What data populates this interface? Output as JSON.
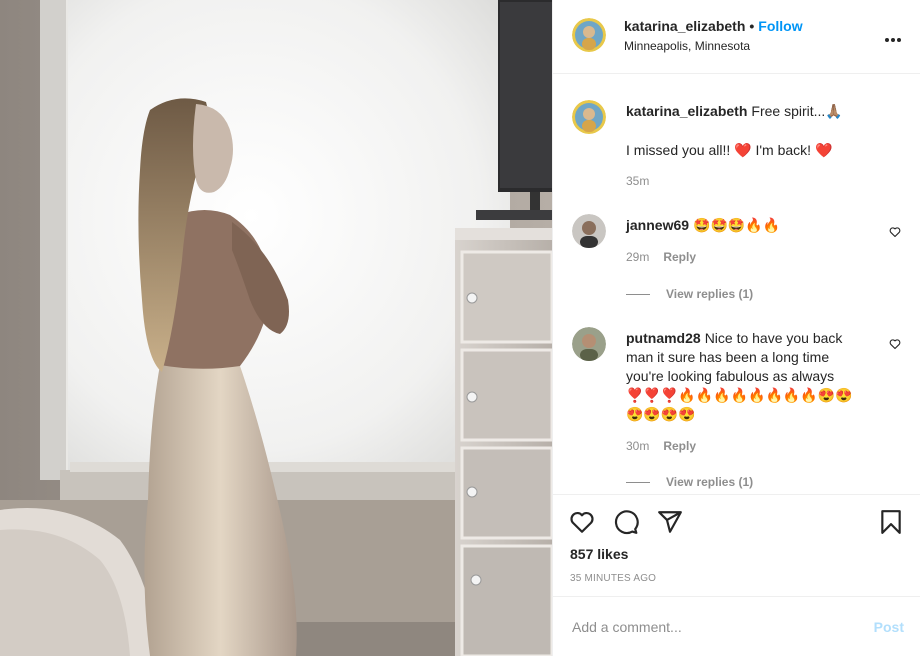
{
  "header": {
    "username": "katarina_elizabeth",
    "separator": "•",
    "follow_label": "Follow",
    "location": "Minneapolis, Minnesota"
  },
  "caption": {
    "username": "katarina_elizabeth",
    "line1": "Free spirit...🙏🏽",
    "line2": "I missed you all!! ❤️ I'm back! ❤️",
    "time": "35m"
  },
  "comments": [
    {
      "username": "jannew69",
      "text": "🤩🤩🤩🔥🔥",
      "time": "29m",
      "reply_label": "Reply",
      "view_replies": "View replies (1)"
    },
    {
      "username": "putnamd28",
      "text": "Nice to have you back man it sure has been a long time you're looking fabulous as always ❣️❣️❣️🔥🔥🔥🔥🔥🔥🔥🔥😍😍😍😍😍😍",
      "time": "30m",
      "reply_label": "Reply",
      "view_replies": "View replies (1)"
    }
  ],
  "actions": {
    "icons": [
      "heart-icon",
      "comment-icon",
      "share-icon",
      "bookmark-icon"
    ],
    "likes": "857 likes",
    "time_ago": "35 MINUTES AGO"
  },
  "add_comment": {
    "placeholder": "Add a comment...",
    "post_label": "Post"
  },
  "colors": {
    "accent": "#0095f6",
    "post_disabled": "#b2dffc",
    "muted": "#8e8e8e",
    "text": "#262626"
  }
}
